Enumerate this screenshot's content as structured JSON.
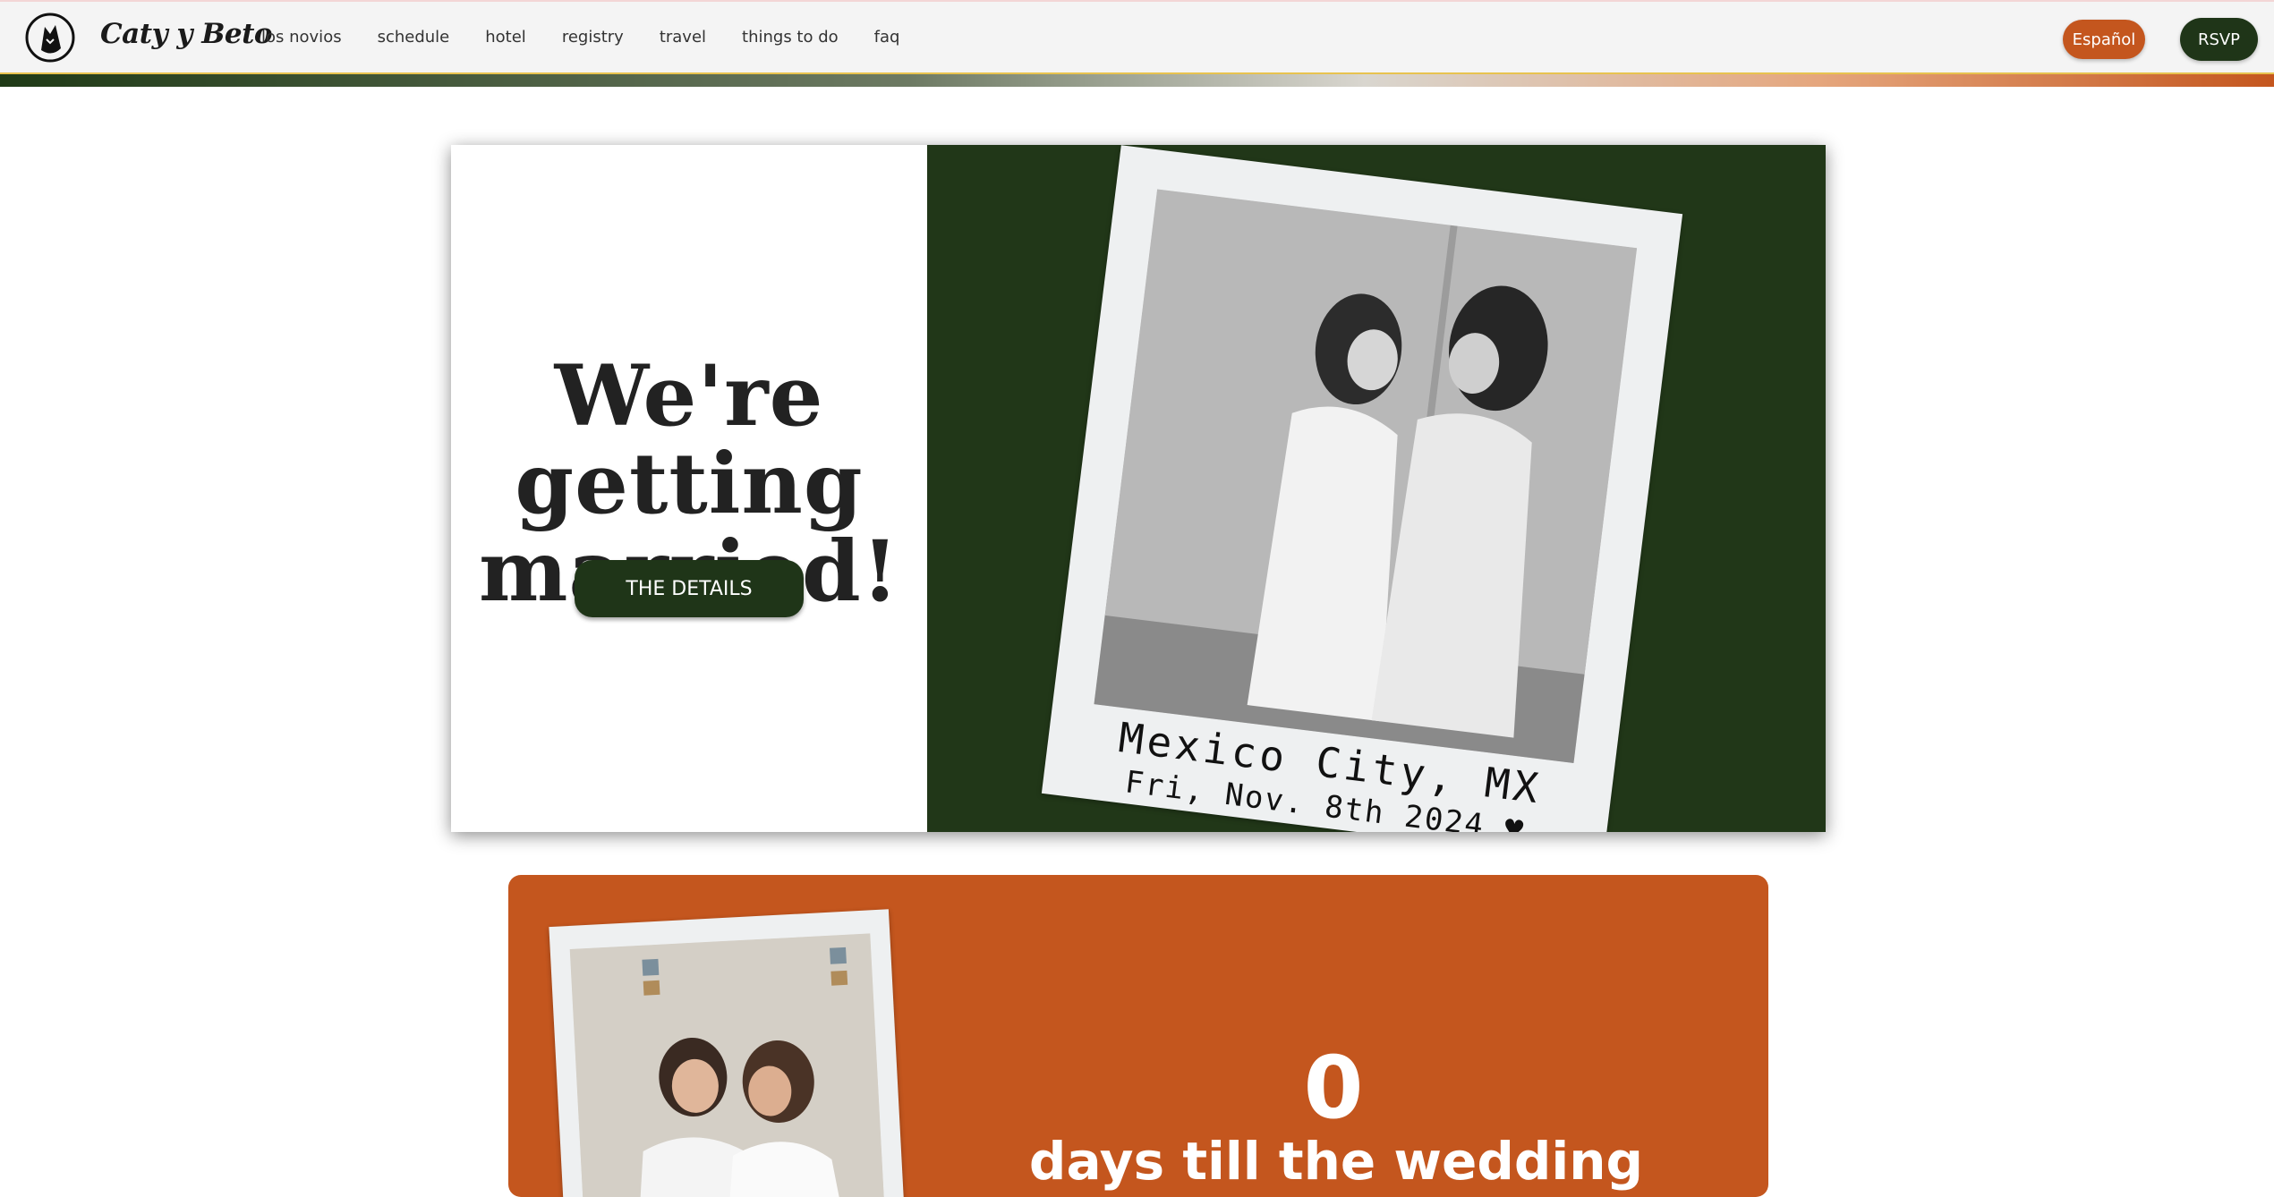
{
  "nav": {
    "brand": "Caty y Beto",
    "logo_icon": "wolf-logo-icon",
    "links": [
      "los novios",
      "schedule",
      "hotel",
      "registry",
      "travel",
      "things to do",
      "faq"
    ],
    "lang_button": "Español",
    "rsvp_button": "RSVP"
  },
  "hero": {
    "title_line1": "We're getting",
    "title_line2": "married!",
    "details_button": "THE DETAILS",
    "caption_line1": "Mexico City, MX",
    "caption_line2": "Fri, Nov. 8th 2024 ♥"
  },
  "countdown": {
    "number": "0",
    "label": "days till the wedding"
  },
  "colors": {
    "dark_green": "#1f3518",
    "orange": "#c4561e",
    "hero_panel_green": "#213718"
  }
}
